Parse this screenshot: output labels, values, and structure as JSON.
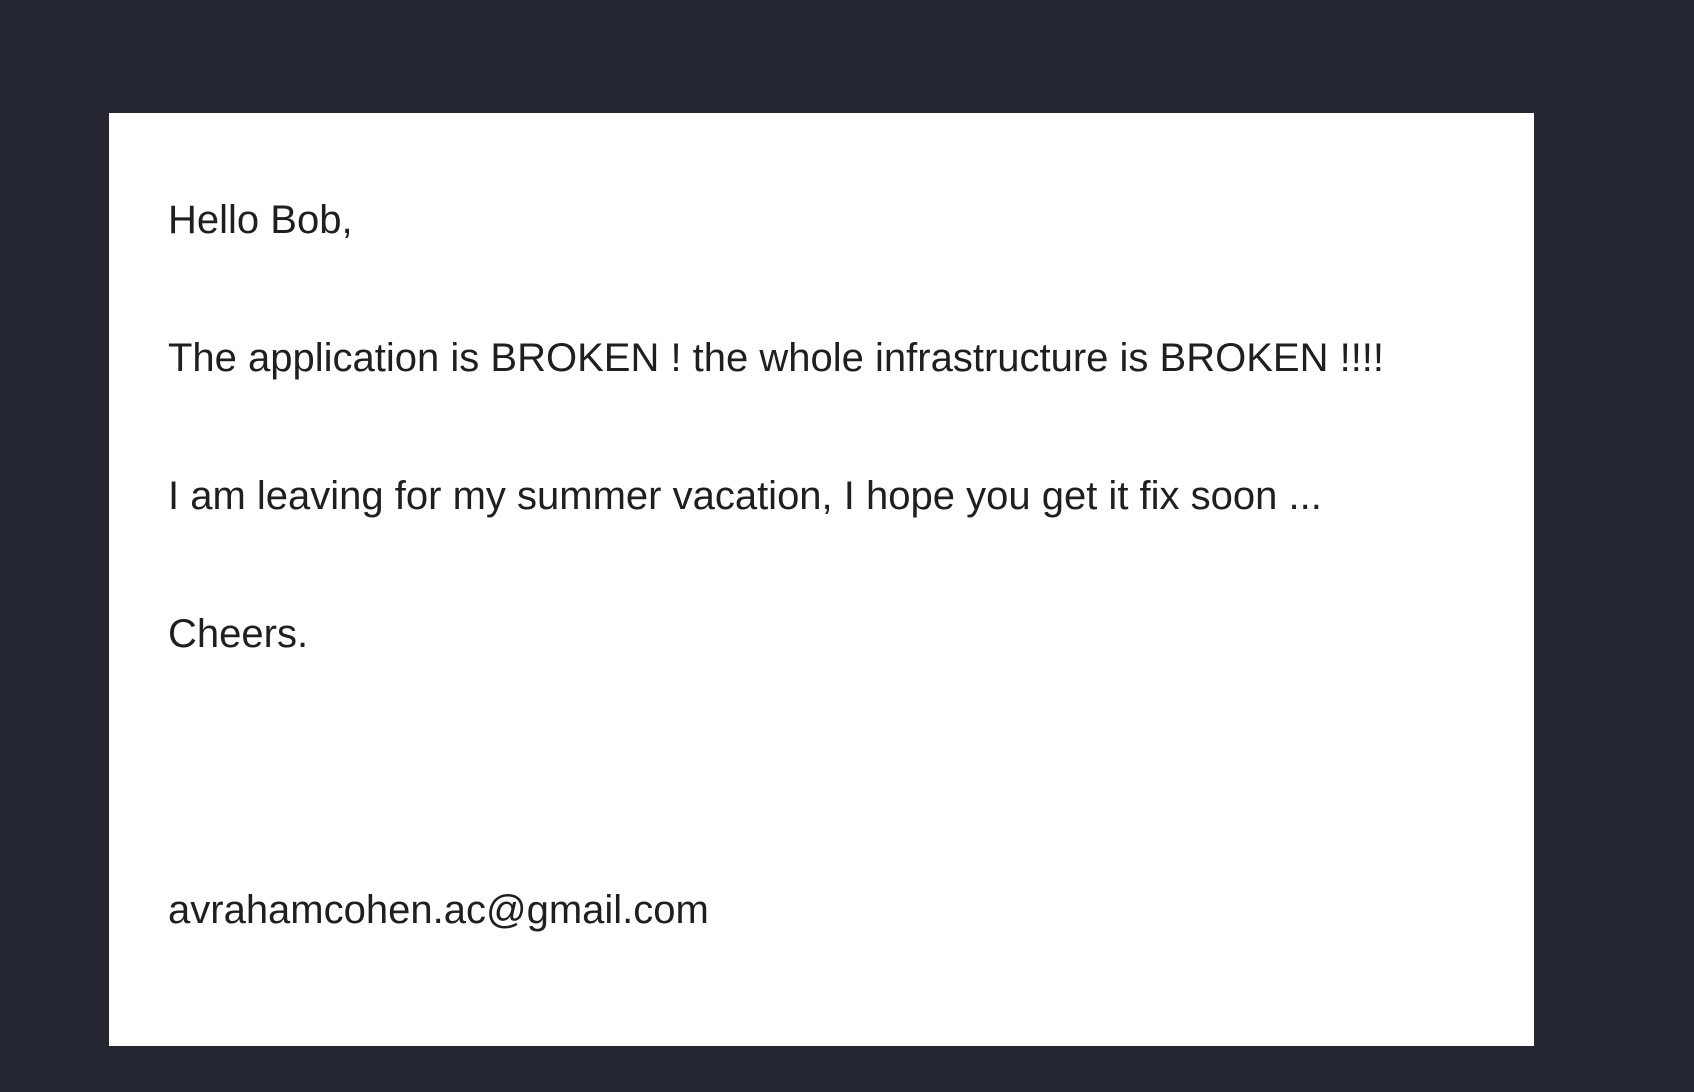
{
  "letter": {
    "greeting": "Hello Bob,",
    "paragraphs": [
      "The application is BROKEN ! the whole infrastructure is BROKEN !!!!",
      "I am leaving for my summer vacation, I hope you get it fix soon ..."
    ],
    "closing": "Cheers.",
    "signature_email": "avrahamcohen.ac@gmail.com"
  },
  "colors": {
    "background": "#242731",
    "page": "#ffffff",
    "text": "#1f1f1f"
  }
}
